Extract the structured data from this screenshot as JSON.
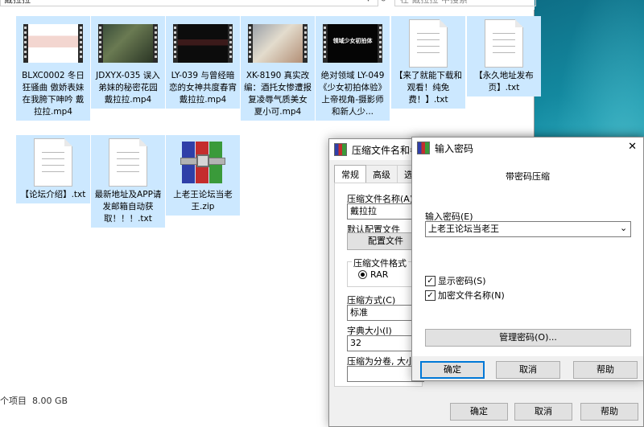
{
  "explorer": {
    "address": "戴拉拉",
    "search_placeholder": "在 戴拉拉 中搜索",
    "status_text": "个项目",
    "status_size": "8.00 GB",
    "files": [
      {
        "name": "BLXC0002 冬日狂骚曲 傲娇表妹在我胯下呻吟 戴拉拉.mp4",
        "type": "video"
      },
      {
        "name": "JDXYX-035 误入弟妹的秘密花园 戴拉拉.mp4",
        "type": "video"
      },
      {
        "name": "LY-039 与曾经暗恋的女神共度春宵 戴拉拉.mp4",
        "type": "video"
      },
      {
        "name": "XK-8190 真实改编：酒托女惨遭报复凌辱气质美女 夏小可.mp4",
        "type": "video"
      },
      {
        "name": "绝对领域 LY-049《少女初拍体验》上帝视角-摄影师和新人少...",
        "type": "video",
        "thumb_text": "领域少女初拍体"
      },
      {
        "name": "【来了就能下载和观看！纯免费！】.txt",
        "type": "text"
      },
      {
        "name": "【永久地址发布页】.txt",
        "type": "text"
      },
      {
        "name": "【论坛介绍】.txt",
        "type": "text"
      },
      {
        "name": "最新地址及APP请发邮箱自动获取！！！.txt",
        "type": "text"
      },
      {
        "name": "上老王论坛当老王.zip",
        "type": "archive"
      }
    ]
  },
  "compress_dialog": {
    "title": "压缩文件名和参数",
    "tabs": [
      "常规",
      "高级",
      "选"
    ],
    "archive_name_label": "压缩文件名称(A)",
    "archive_name_value": "戴拉拉",
    "default_profile_label": "默认配置文件",
    "profile_button": "配置文件",
    "format_label": "压缩文件格式",
    "format_rar": "RAR",
    "method_label": "压缩方式(C)",
    "method_value": "标准",
    "dict_label": "字典大小(I)",
    "dict_value": "32",
    "split_label": "压缩为分卷, 大小",
    "ok": "确定",
    "cancel": "取消",
    "help": "帮助"
  },
  "password_dialog": {
    "title": "输入密码",
    "close_glyph": "✕",
    "heading": "带密码压缩",
    "password_label": "输入密码(E)",
    "password_value": "上老王论坛当老王",
    "show_password": "显示密码(S)",
    "encrypt_names": "加密文件名称(N)",
    "manage": "管理密码(O)...",
    "ok": "确定",
    "cancel": "取消",
    "help": "帮助"
  }
}
